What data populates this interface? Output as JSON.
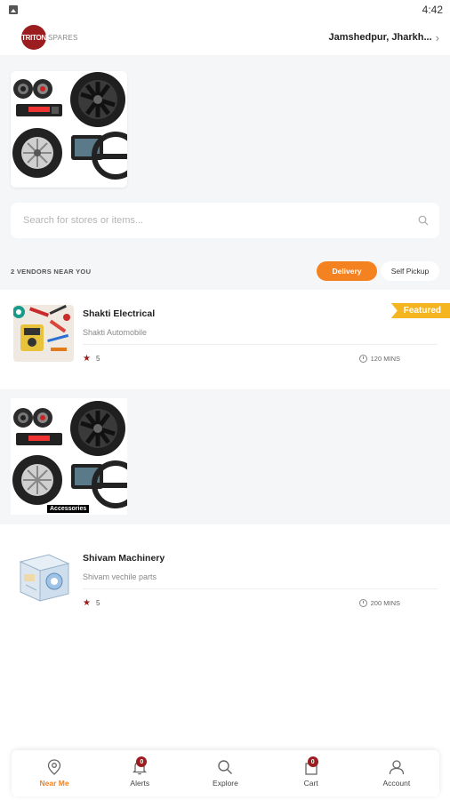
{
  "status_bar": {
    "time": "4:42"
  },
  "header": {
    "logo_badge": "TRITON",
    "logo_text": "SPARES",
    "location": "Jamshedpur, Jharkh...",
    "location_icon": "chevron-right-icon"
  },
  "search": {
    "placeholder": "Search for stores or items..."
  },
  "vendors": {
    "count_label": "2 VENDORS NEAR YOU",
    "delivery_label": "Delivery",
    "pickup_label": "Self Pickup",
    "selected": "Delivery"
  },
  "stores": [
    {
      "name": "Shakti Electrical",
      "subtitle": "Shakti Automobile",
      "rating": "5",
      "time": "120 MINS",
      "badge": "Featured"
    },
    {
      "name": "Shivam Machinery",
      "subtitle": "Shivam vechile parts",
      "rating": "5",
      "time": "200 MINS"
    }
  ],
  "promo": {
    "label": "Accessories"
  },
  "nav": {
    "items": [
      {
        "label": "Near Me",
        "icon": "location-pin-icon"
      },
      {
        "label": "Alerts",
        "icon": "bell-icon",
        "badge": "0"
      },
      {
        "label": "Explore",
        "icon": "search-icon"
      },
      {
        "label": "Cart",
        "icon": "bag-icon",
        "badge": "0"
      },
      {
        "label": "Account",
        "icon": "user-icon"
      }
    ]
  },
  "colors": {
    "accent": "#f58220",
    "brand": "#9b1d20",
    "featured": "#f5b521"
  }
}
